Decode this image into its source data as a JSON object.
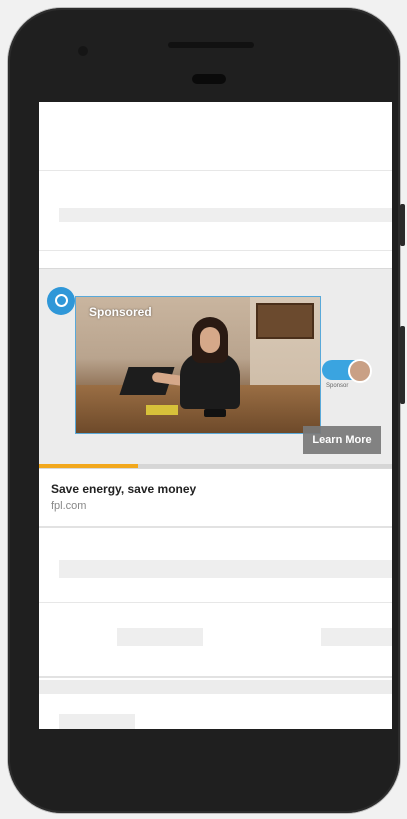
{
  "ad": {
    "sponsored_label": "Sponsored",
    "learn_more_label": "Learn More",
    "title": "Save energy, save money",
    "domain": "fpl.com",
    "progress": 0.28,
    "mini_label": "Sponsor",
    "colors": {
      "brand_blue": "#2f97d8",
      "progress": "#f2a81d"
    }
  },
  "icons": {
    "brand": "brand-logo-icon",
    "avatar": "avatar-icon"
  }
}
